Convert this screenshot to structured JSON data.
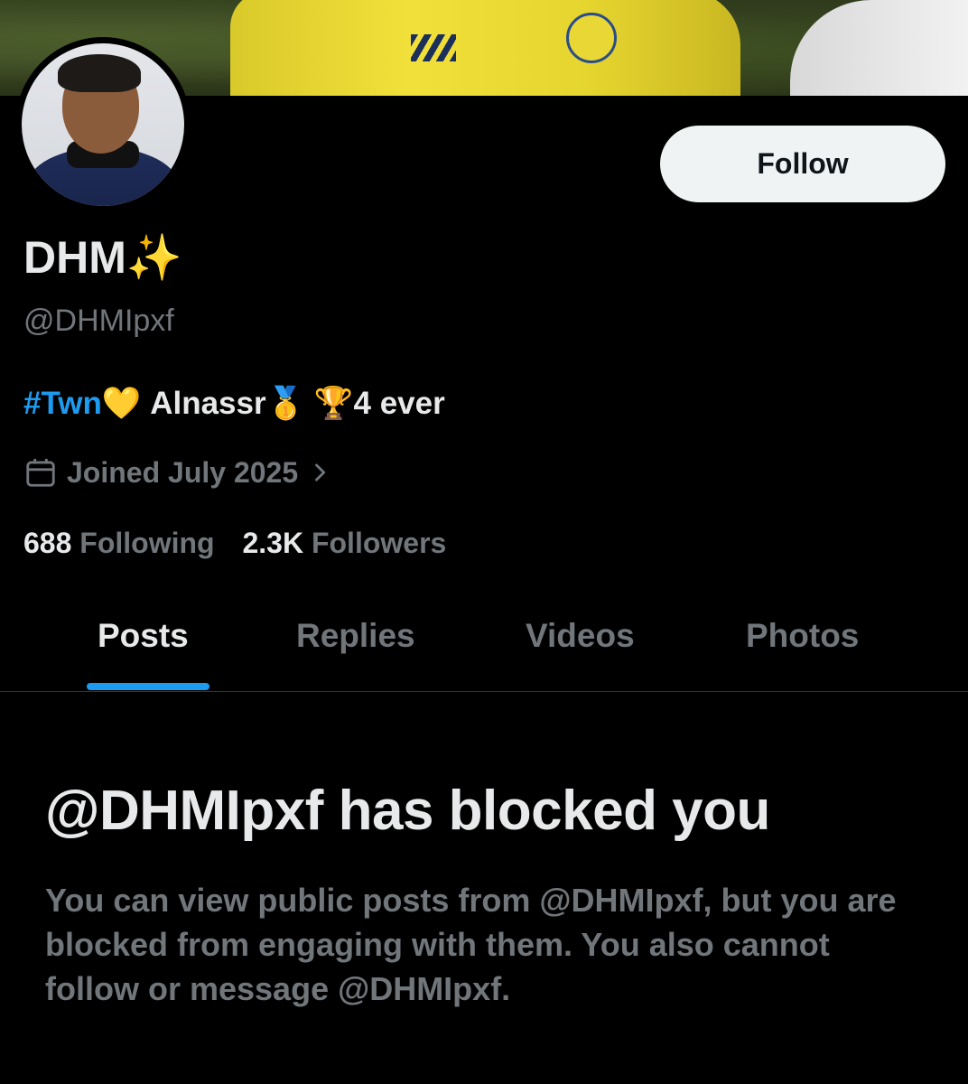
{
  "profile": {
    "name": "DHM",
    "name_emoji": "✨",
    "handle": "@DHMIpxf",
    "bio_hashtag": "#Twn",
    "bio_heart": "💛",
    "bio_text_1": "Alnassr",
    "bio_medal": "🥇",
    "bio_trophy": "🏆",
    "bio_text_2": "4 ever",
    "joined": "Joined July 2025",
    "following_count": "688",
    "following_label": "Following",
    "followers_count": "2.3K",
    "followers_label": "Followers"
  },
  "actions": {
    "follow_label": "Follow"
  },
  "tabs": [
    {
      "label": "Posts",
      "active": true
    },
    {
      "label": "Replies",
      "active": false
    },
    {
      "label": "Videos",
      "active": false
    },
    {
      "label": "Photos",
      "active": false
    }
  ],
  "blocked": {
    "title": "@DHMIpxf has blocked you",
    "message": "You can view public posts from @DHMIpxf, but you are blocked from engaging with them. You also cannot follow or message @DHMIpxf."
  },
  "colors": {
    "background": "#000000",
    "accent": "#1d9bf0",
    "primary_text": "#e7e9ea",
    "secondary_text": "#71767b"
  },
  "icons": [
    "calendar-icon",
    "chevron-right-icon"
  ]
}
